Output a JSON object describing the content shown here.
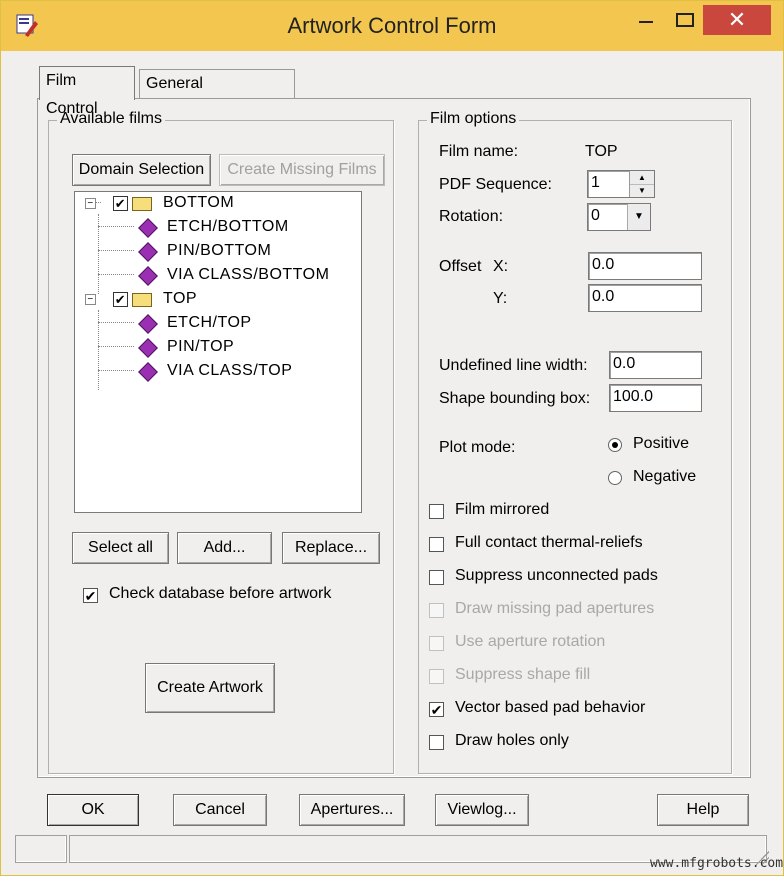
{
  "window": {
    "title": "Artwork Control Form",
    "close_glyph": "✕"
  },
  "tabs": [
    {
      "label": "Film Control"
    },
    {
      "label": "General Parameters"
    }
  ],
  "available_films": {
    "group_label": "Available films",
    "domain_selection_label": "Domain Selection",
    "create_missing_label": "Create Missing Films",
    "tree": [
      {
        "label": "BOTTOM",
        "checked": true,
        "children": [
          "ETCH/BOTTOM",
          "PIN/BOTTOM",
          "VIA CLASS/BOTTOM"
        ]
      },
      {
        "label": "TOP",
        "checked": true,
        "children": [
          "ETCH/TOP",
          "PIN/TOP",
          "VIA CLASS/TOP"
        ]
      }
    ],
    "select_all_label": "Select all",
    "add_label": "Add...",
    "replace_label": "Replace...",
    "check_db_label": "Check database before artwork",
    "check_db_checked": true,
    "create_artwork_label": "Create Artwork"
  },
  "film_options": {
    "group_label": "Film options",
    "film_name_label": "Film name:",
    "film_name_value": "TOP",
    "pdf_sequence_label": "PDF Sequence:",
    "pdf_sequence_value": "1",
    "rotation_label": "Rotation:",
    "rotation_value": "0",
    "offset_label": "Offset",
    "offset_x_label": "X:",
    "offset_x_value": "0.0",
    "offset_y_label": "Y:",
    "offset_y_value": "0.0",
    "undefined_line_width_label": "Undefined line width:",
    "undefined_line_width_value": "0.0",
    "shape_bounding_box_label": "Shape bounding box:",
    "shape_bounding_box_value": "100.0",
    "plot_mode_label": "Plot mode:",
    "plot_mode_options": [
      "Positive",
      "Negative"
    ],
    "plot_mode_selected": "Positive",
    "checkboxes": [
      {
        "label": "Film mirrored",
        "checked": false,
        "enabled": true
      },
      {
        "label": "Full contact thermal-reliefs",
        "checked": false,
        "enabled": true
      },
      {
        "label": "Suppress unconnected pads",
        "checked": false,
        "enabled": true
      },
      {
        "label": "Draw missing pad apertures",
        "checked": false,
        "enabled": false
      },
      {
        "label": "Use aperture rotation",
        "checked": false,
        "enabled": false
      },
      {
        "label": "Suppress shape fill",
        "checked": false,
        "enabled": false
      },
      {
        "label": "Vector based pad behavior",
        "checked": true,
        "enabled": true
      },
      {
        "label": "Draw holes only",
        "checked": false,
        "enabled": true
      }
    ]
  },
  "bottom_buttons": {
    "ok": "OK",
    "cancel": "Cancel",
    "apertures": "Apertures...",
    "viewlog": "Viewlog...",
    "help": "Help"
  },
  "watermark": "www.mfgrobots.com"
}
